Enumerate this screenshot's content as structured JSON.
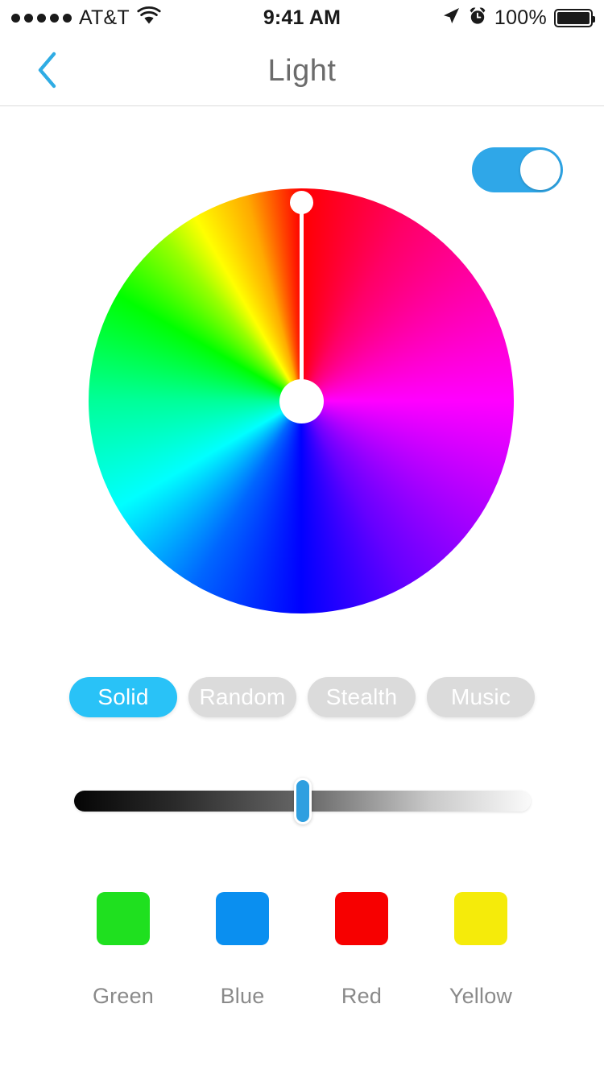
{
  "status_bar": {
    "signal_dots": 5,
    "carrier": "AT&T",
    "wifi_icon": "wifi-icon",
    "time": "9:41 AM",
    "location_icon": "location-arrow-icon",
    "alarm_icon": "alarm-clock-icon",
    "battery_percent": "100%",
    "battery_level": 100
  },
  "nav_bar": {
    "back_icon": "chevron-left-icon",
    "title": "Light",
    "accent_color": "#2FA7E8"
  },
  "power": {
    "label": "power-toggle",
    "on": true,
    "on_color": "#2FA7E8"
  },
  "color_wheel": {
    "name": "hue-color-wheel",
    "selected_hue_degrees": 0,
    "selected_color": "#ff0000",
    "handle_position": "top"
  },
  "modes": {
    "selected": "Solid",
    "active_color": "#29C2F7",
    "inactive_color": "#dbdbdb",
    "items": [
      {
        "label": "Solid",
        "active": true
      },
      {
        "label": "Random",
        "active": false
      },
      {
        "label": "Stealth",
        "active": false
      },
      {
        "label": "Music",
        "active": false
      }
    ]
  },
  "brightness": {
    "name": "brightness-slider",
    "value_percent": 50,
    "track_from": "#050505",
    "track_to": "#fafafa",
    "thumb_color": "#2F9FE0"
  },
  "presets": [
    {
      "label": "Green",
      "color": "#1FE01F"
    },
    {
      "label": "Blue",
      "color": "#0A8FF0"
    },
    {
      "label": "Red",
      "color": "#F70000"
    },
    {
      "label": "Yellow",
      "color": "#F5EB0A"
    }
  ]
}
